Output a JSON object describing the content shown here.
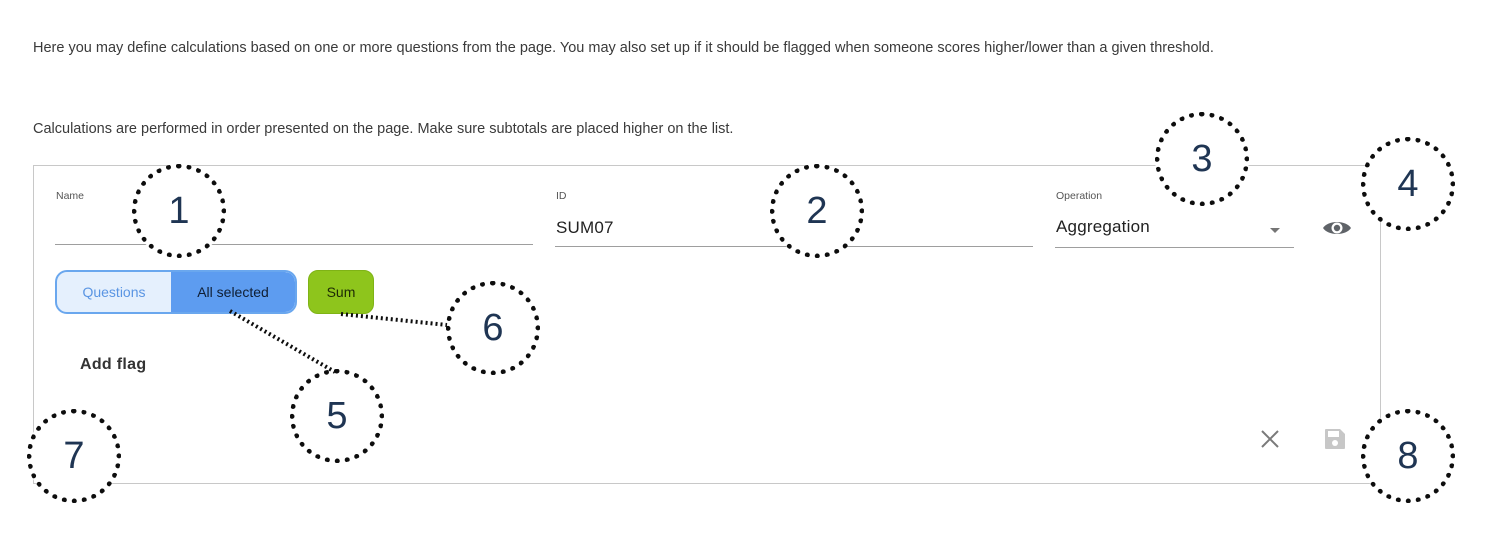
{
  "intro": {
    "line1": "Here you may define calculations based on one or more questions from the page. You may also set up if it should be flagged when someone scores higher/lower than a given threshold.",
    "line2": "Calculations are performed in order presented on the page. Make sure subtotals are placed higher on the list."
  },
  "form": {
    "name": {
      "label": "Name",
      "value": ""
    },
    "id": {
      "label": "ID",
      "value": "SUM07"
    },
    "operation": {
      "label": "Operation",
      "value": "Aggregation"
    }
  },
  "questions_toggle": {
    "options": [
      "Questions",
      "All selected"
    ],
    "selected": "All selected"
  },
  "sum_chip": {
    "label": "Sum"
  },
  "add_flag": {
    "label": "Add flag"
  },
  "icons": {
    "preview": "eye-icon",
    "cancel": "close-icon",
    "save": "save-icon"
  },
  "callouts": [
    "1",
    "2",
    "3",
    "4",
    "5",
    "6",
    "7",
    "8"
  ],
  "colors": {
    "toggle_bg": "#e5f0fd",
    "toggle_selected": "#5d9cf0",
    "toggle_border": "#6aa7ee",
    "sum_chip": "#8ec51c",
    "callout_number": "#1f3553"
  }
}
